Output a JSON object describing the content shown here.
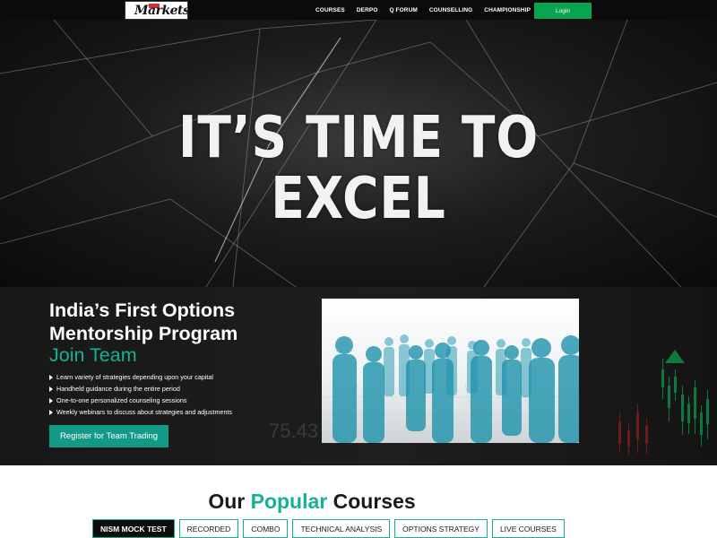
{
  "brand": {
    "logo_text": "Markets"
  },
  "nav": {
    "links": [
      "COURSES",
      "DERPO",
      "Q FORUM",
      "COUNSELLING",
      "CHAMPIONSHIP"
    ],
    "cart_icon": "cart-icon",
    "login_label": "Login",
    "accent_color": "#0aa34f"
  },
  "hero": {
    "line1": "IT’S TIME TO",
    "line2": "EXCEL"
  },
  "promo": {
    "title_line1": "India’s First Options",
    "title_line2": "Mentorship Program",
    "accent": "Join Team",
    "bullets": [
      "Learn variety of strategies depending upon your capital",
      "Handheld guidance during the entire period",
      "One-to-one personalized counseling sessions",
      "Weekly webinars to discuss about strategies and adjustments"
    ],
    "cta_label": "Register for Team Trading",
    "background_number": "75.43",
    "accent_color": "#16b192"
  },
  "courses": {
    "heading_prefix": "Our ",
    "heading_accent": "Popular",
    "heading_suffix": " Courses",
    "tabs": [
      "NISM MOCK TEST",
      "RECORDED",
      "COMBO",
      "TECHNICAL ANALYSIS",
      "OPTIONS STRATEGY",
      "LIVE COURSES"
    ],
    "active_tab": "NISM MOCK TEST"
  }
}
